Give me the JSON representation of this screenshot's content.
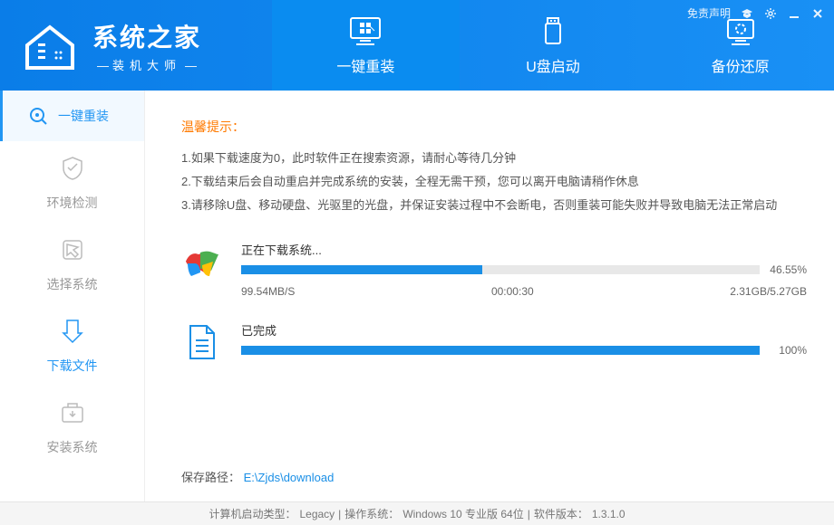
{
  "branding": {
    "title": "系统之家",
    "subtitle": "装机大师"
  },
  "titlebar": {
    "disclaimer": "免责声明"
  },
  "top_tabs": [
    {
      "label": "一键重装",
      "active": true
    },
    {
      "label": "U盘启动",
      "active": false
    },
    {
      "label": "备份还原",
      "active": false
    }
  ],
  "sidebar": {
    "header": "一键重装",
    "items": [
      {
        "label": "环境检测"
      },
      {
        "label": "选择系统"
      },
      {
        "label": "下载文件"
      },
      {
        "label": "安装系统"
      }
    ],
    "current_index": 2
  },
  "tips": {
    "title": "温馨提示：",
    "lines": [
      "1.如果下载速度为0，此时软件正在搜索资源，请耐心等待几分钟",
      "2.下载结束后会自动重启并完成系统的安装，全程无需干预，您可以离开电脑请稍作休息",
      "3.请移除U盘、移动硬盘、光驱里的光盘，并保证安装过程中不会断电，否则重装可能失败并导致电脑无法正常启动"
    ]
  },
  "download": {
    "label": "正在下载系统...",
    "percent": 46.55,
    "percent_text": "46.55%",
    "speed": "99.54MB/S",
    "elapsed": "00:00:30",
    "size": "2.31GB/5.27GB"
  },
  "completed": {
    "label": "已完成",
    "percent": 100,
    "percent_text": "100%"
  },
  "save_path": {
    "label": "保存路径：",
    "value": "E:\\Zjds\\download"
  },
  "footer": {
    "boot_type_label": "计算机启动类型：",
    "boot_type": "Legacy",
    "os_label": "操作系统：",
    "os": "Windows 10 专业版 64位",
    "version_label": "软件版本：",
    "version": "1.3.1.0"
  }
}
